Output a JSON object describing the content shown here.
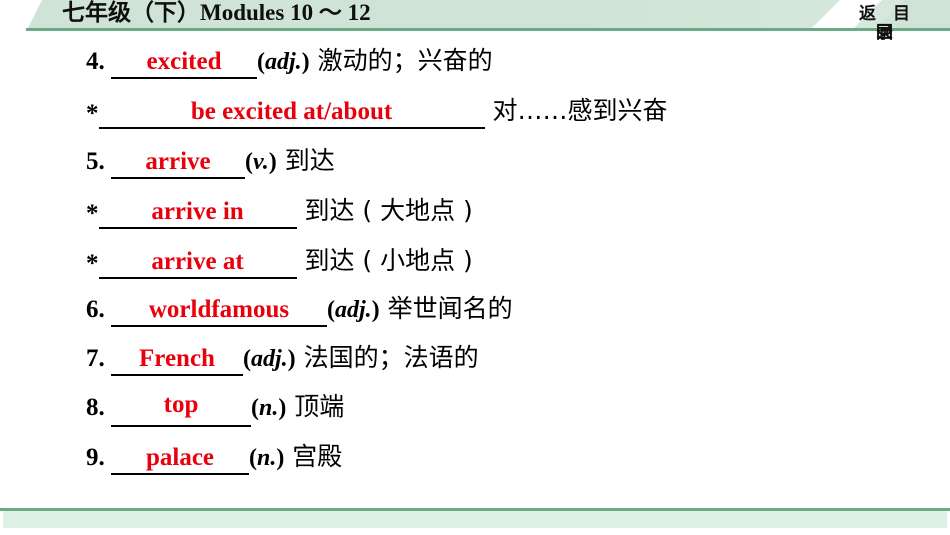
{
  "header": {
    "title_cn": "七年级（下）",
    "title_latin": "Modules 10 ～ 12",
    "back_button": {
      "label": "返回目录",
      "char1": "返",
      "char2": "回",
      "char3": "目",
      "char4": "录"
    }
  },
  "accent_colors": {
    "band_green": "#cfe4d6",
    "rule_green": "#6aab86",
    "answer_red": "#e8000d",
    "text_black": "#000000",
    "footer_fill": "#dff0e5"
  },
  "entries": [
    {
      "marker": "4.",
      "answer": "excited",
      "pos_open": "(",
      "pos": "adj.",
      "pos_close": ")",
      "meaning": " 激动的；兴奋的"
    },
    {
      "marker": "*",
      "answer": "be excited at/about",
      "pos_open": "",
      "pos": "",
      "pos_close": "",
      "meaning": " 对……感到兴奋"
    },
    {
      "marker": "5.",
      "answer": "arrive",
      "pos_open": "(",
      "pos": "v.",
      "pos_close": ")",
      "meaning": " 到达"
    },
    {
      "marker": "*",
      "answer": "arrive in",
      "pos_open": "",
      "pos": "",
      "pos_close": "",
      "meaning": " 到达 ( 大地点 )"
    },
    {
      "marker": "*",
      "answer": "arrive at",
      "pos_open": "",
      "pos": "",
      "pos_close": "",
      "meaning": " 到达 ( 小地点 )"
    },
    {
      "marker": "6.",
      "answer": "worldfamous",
      "pos_open": "(",
      "pos": "adj.",
      "pos_close": ")",
      "meaning": " 举世闻名的"
    },
    {
      "marker": "7.",
      "answer": "French",
      "pos_open": "(",
      "pos": "adj.",
      "pos_close": ")",
      "meaning": " 法国的；法语的"
    },
    {
      "marker": "8.",
      "answer": "top",
      "pos_open": "(",
      "pos": "n.",
      "pos_close": ")",
      "meaning": " 顶端"
    },
    {
      "marker": "9.",
      "answer": "palace",
      "pos_open": "(",
      "pos": "n.",
      "pos_close": ")",
      "meaning": " 宫殿"
    }
  ]
}
